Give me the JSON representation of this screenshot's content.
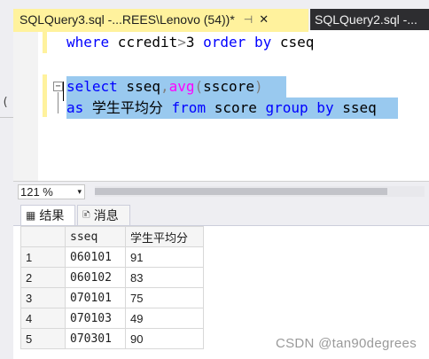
{
  "tabs": [
    {
      "label": "SQLQuery3.sql -...REES\\Lenovo (54))*",
      "pin_icon": "⊣",
      "close_icon": "✕"
    },
    {
      "label": "SQLQuery2.sql -..."
    }
  ],
  "left_strip": {
    "glyph": "("
  },
  "editor": {
    "lines": [
      {
        "tokens": [
          "where",
          " ccredit",
          ">",
          "3",
          " order",
          " by",
          " cseq"
        ]
      },
      {
        "tokens": []
      },
      {
        "tokens": [
          "select",
          " sseq",
          ",",
          "avg",
          "(",
          "sscore",
          ")"
        ]
      },
      {
        "tokens": [
          "as",
          " 学生平均分",
          " from",
          " score",
          " group",
          " by",
          " sseq"
        ]
      }
    ],
    "collapse_glyph": "−"
  },
  "zoom": {
    "value": "121 %",
    "arrow": "▾"
  },
  "results_tabs": [
    {
      "label": "结果",
      "icon": "▦"
    },
    {
      "label": "消息",
      "icon": "🗈"
    }
  ],
  "grid": {
    "columns": [
      "",
      "sseq",
      "学生平均分"
    ],
    "rows": [
      [
        "1",
        "060101",
        "91"
      ],
      [
        "2",
        "060102",
        "83"
      ],
      [
        "3",
        "070101",
        "75"
      ],
      [
        "4",
        "070103",
        "49"
      ],
      [
        "5",
        "070301",
        "90"
      ]
    ]
  },
  "watermark": "CSDN @tan90degrees",
  "colors": {
    "active_tab": "#fff29d",
    "inactive_tab": "#2d2d30",
    "selection": "#99c9ef",
    "keyword": "#0000ff",
    "function": "#ff00ff"
  }
}
